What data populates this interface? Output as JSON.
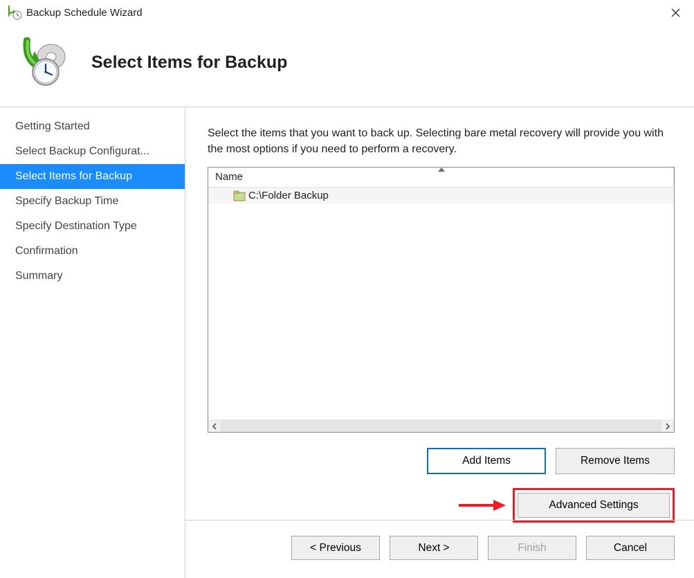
{
  "window": {
    "title": "Backup Schedule Wizard"
  },
  "header": {
    "title": "Select Items for Backup"
  },
  "steps": {
    "items": [
      {
        "label": "Getting Started",
        "active": false
      },
      {
        "label": "Select Backup Configurat...",
        "active": false
      },
      {
        "label": "Select Items for Backup",
        "active": true
      },
      {
        "label": "Specify Backup Time",
        "active": false
      },
      {
        "label": "Specify Destination Type",
        "active": false
      },
      {
        "label": "Confirmation",
        "active": false
      },
      {
        "label": "Summary",
        "active": false
      }
    ]
  },
  "main": {
    "instructions": "Select the items that you want to back up. Selecting bare metal recovery will provide you with the most options if you need to perform a recovery.",
    "columns": {
      "name": "Name"
    },
    "rows": [
      {
        "label": "C:\\Folder Backup"
      }
    ],
    "buttons": {
      "add": "Add Items",
      "remove": "Remove Items",
      "advanced": "Advanced Settings"
    }
  },
  "footer": {
    "previous": "< Previous",
    "next": "Next >",
    "finish": "Finish",
    "cancel": "Cancel"
  }
}
